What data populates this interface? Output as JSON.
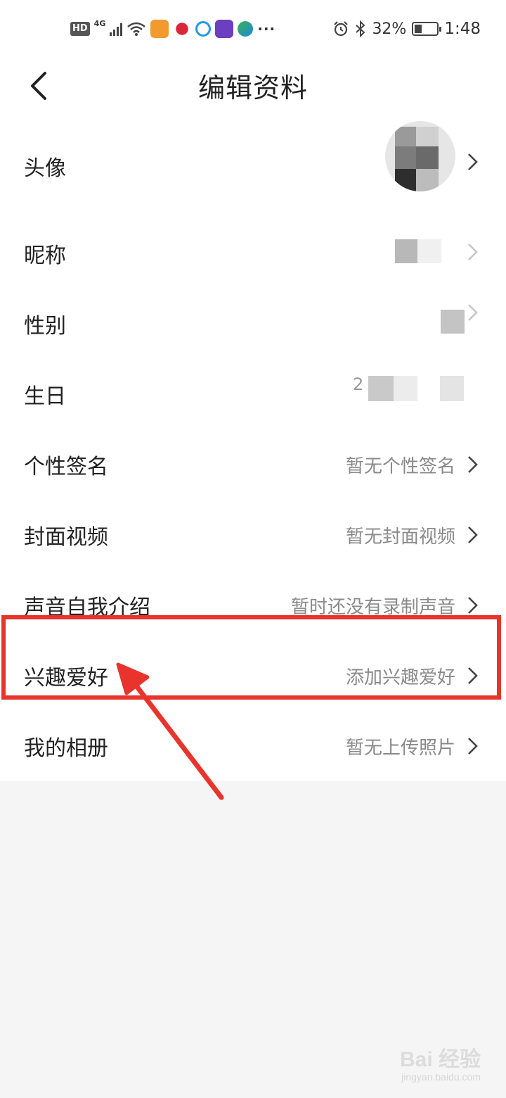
{
  "status_bar": {
    "hd": "HD",
    "network": "4G",
    "more": "···",
    "battery_text": "32%",
    "time": "1:48"
  },
  "nav": {
    "title": "编辑资料"
  },
  "rows": [
    {
      "label": "头像",
      "value": ""
    },
    {
      "label": "昵称",
      "value": ""
    },
    {
      "label": "性别",
      "value": ""
    },
    {
      "label": "生日",
      "value": "2"
    },
    {
      "label": "个性签名",
      "value": "暂无个性签名"
    },
    {
      "label": "封面视频",
      "value": "暂无封面视频"
    },
    {
      "label": "声音自我介绍",
      "value": "暂时还没有录制声音"
    },
    {
      "label": "兴趣爱好",
      "value": "添加兴趣爱好"
    },
    {
      "label": "我的相册",
      "value": "暂无上传照片"
    }
  ],
  "colors": {
    "highlight": "#e8342c",
    "value_text": "#8a8a8a",
    "background": "#f5f5f5"
  },
  "watermark": {
    "main": "Bai 经验",
    "sub": "jingyan.baidu.com"
  }
}
